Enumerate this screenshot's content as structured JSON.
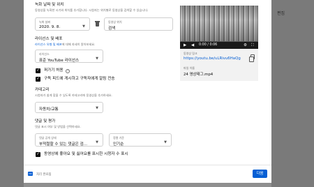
{
  "backdrop": {
    "right_text": "편집"
  },
  "recording": {
    "heading": "녹화 날짜 및 위치",
    "description": "동영상을 녹화한 시기와 위치를 추가합니다. 시청자는 위치별로 동영상을 검색할 수 있습니다.",
    "date_label": "녹화 날짜",
    "date_value": "2020. 9. 8.",
    "location_label": "동영상 위치",
    "location_value": "검색"
  },
  "license": {
    "heading": "라이선스 및 배포",
    "description_links": "라이선스 유형 및 배포",
    "description_rest": "에 대해 자세히 알아보세요.",
    "label": "라이선스",
    "value": "표준 YouTube 라이선스"
  },
  "checkboxes": {
    "embed": "퍼가기 허용",
    "notify": "구독 피드에 게시하고 구독자에게 알림 전송"
  },
  "category": {
    "heading": "카테고리",
    "description": "시청자가 쉽게 찾을 수 있도록 카테고리에 동영상을 추가하세요.",
    "value": "자동차/교통"
  },
  "comments": {
    "heading": "댓글 및 평가",
    "description": "댓글 표시 여부 및 방법을 선택하세요.",
    "visibility_label": "댓글 공개 상태",
    "visibility_value": "부적절할 수 있는 댓글은 검...",
    "sort_label": "정렬 기준",
    "sort_value": "인기순",
    "ratings_checkbox": "동영상에 좋아요 및 싫어요를 표시한 시청자 수 표시"
  },
  "video": {
    "time": "0:00 / 0:06",
    "link_label": "동영상 링크",
    "link_value": "https://youtu.be/uLRivu6HaQg",
    "filename_label": "파일 이름",
    "filename_value": "24 영상태그.mp4"
  },
  "footer": {
    "badge": "HD",
    "status": "처리 완료됨",
    "next_button": "다음"
  },
  "icons": {
    "play": "play-icon",
    "volume": "volume-icon",
    "settings": "gear-icon",
    "fullscreen": "fullscreen-icon",
    "copy": "copy-icon",
    "delete": "trash-icon",
    "help": "help-icon"
  },
  "colors": {
    "accent": "#065fd4",
    "checkbox": "#0d0d0d"
  }
}
